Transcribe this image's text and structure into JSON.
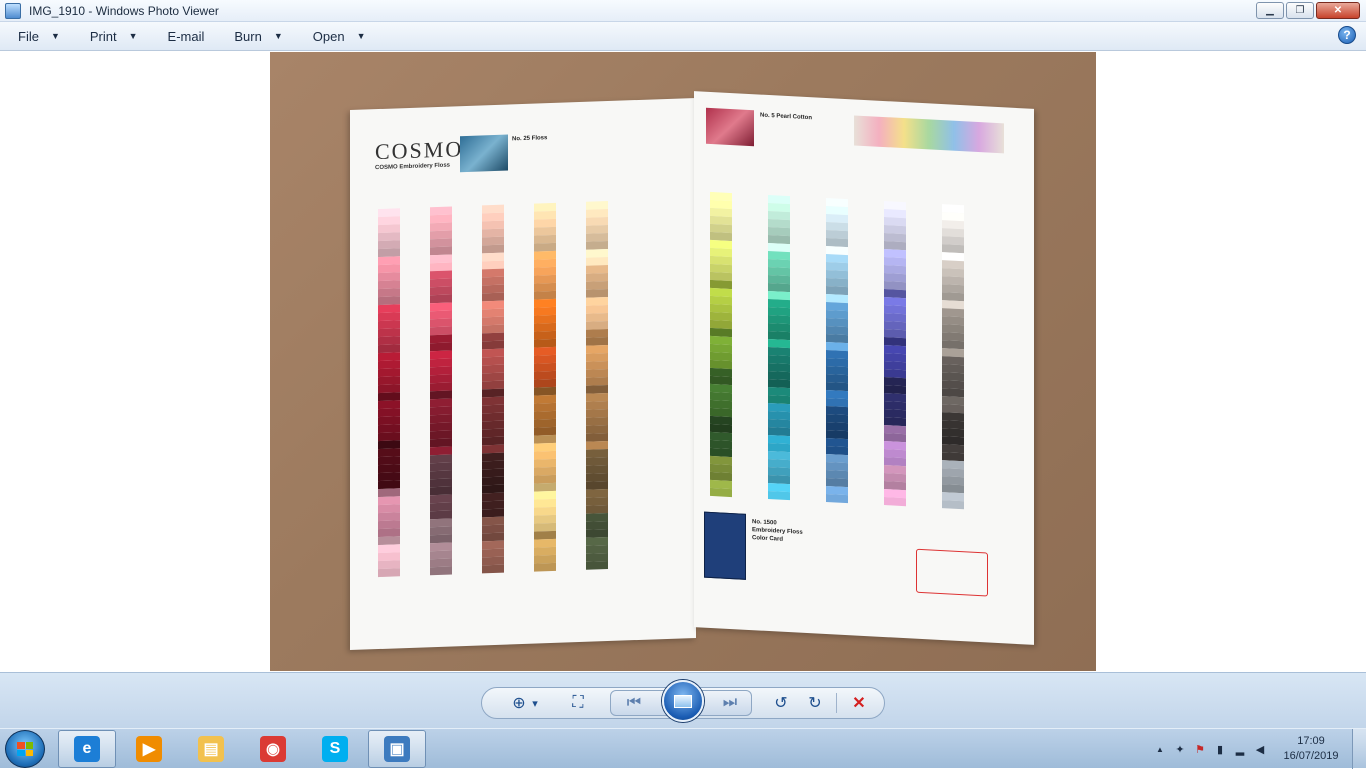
{
  "window": {
    "title": "IMG_1910 - Windows Photo Viewer",
    "minimize_symbol": "▁",
    "maximize_symbol": "❐",
    "close_symbol": "✕"
  },
  "menu": {
    "items": [
      {
        "label": "File",
        "arrow": "▼"
      },
      {
        "label": "Print",
        "arrow": "▼"
      },
      {
        "label": "E-mail",
        "arrow": ""
      },
      {
        "label": "Burn",
        "arrow": "▼"
      },
      {
        "label": "Open",
        "arrow": "▼"
      }
    ],
    "help_symbol": "?"
  },
  "photo": {
    "logo": "COSMO",
    "logo_sub": "COSMO Embroidery Floss",
    "left_heading": "No. 25 Floss",
    "right_heading": "No. 5 Pearl Cotton",
    "card_title_line1": "No. 1500",
    "card_title_line2": "Embroidery Floss",
    "card_title_line3": "Color Card"
  },
  "controls": {
    "zoom_icon": "⊕",
    "zoom_arrow": "▾",
    "actual_size_icon": "⛶",
    "previous_icon": "⏮",
    "next_icon": "⏭",
    "rotate_ccw_icon": "↺",
    "rotate_cw_icon": "↻",
    "delete_icon": "✕"
  },
  "taskbar": {
    "apps": [
      {
        "name": "internet-explorer",
        "glyph": "e",
        "color": "#1c7ed6"
      },
      {
        "name": "media-player",
        "glyph": "▶",
        "color": "#f08c00"
      },
      {
        "name": "file-explorer",
        "glyph": "▤",
        "color": "#f2c14e"
      },
      {
        "name": "chrome",
        "glyph": "◉",
        "color": "#db3a34"
      },
      {
        "name": "skype",
        "glyph": "S",
        "color": "#00aff0"
      },
      {
        "name": "photo-viewer",
        "glyph": "▣",
        "color": "#3d7bbf"
      }
    ],
    "clock_time": "17:09",
    "clock_date": "16/07/2019",
    "tray_up_arrow": "▲"
  }
}
